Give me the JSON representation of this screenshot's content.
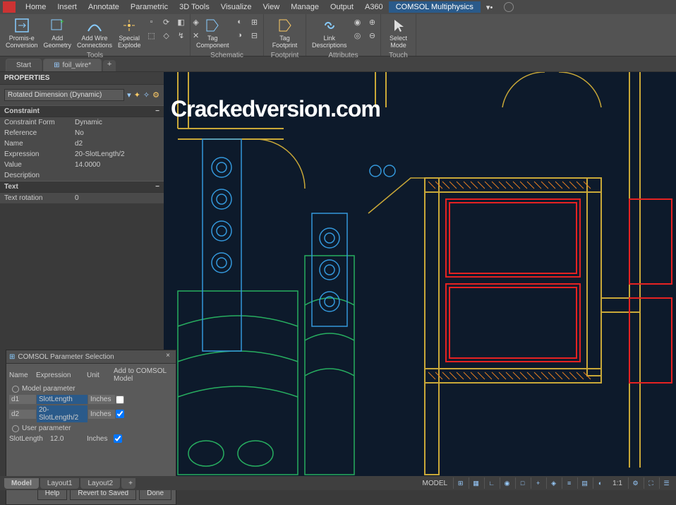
{
  "menu": [
    "Home",
    "Insert",
    "Annotate",
    "Parametric",
    "3D Tools",
    "Visualize",
    "View",
    "Manage",
    "Output",
    "A360"
  ],
  "comsol_tab": "COMSOL Multiphysics",
  "ribbon": {
    "tools": {
      "label": "Tools",
      "promise": "Promis-e Conversion",
      "addgeom": "Add Geometry",
      "addwire": "Add Wire Connections",
      "explode": "Special Explode"
    },
    "schematic": {
      "label": "Schematic",
      "tagcomp": "Tag Component"
    },
    "footprint": {
      "label": "Footprint",
      "tagfp": "Tag Footprint"
    },
    "attributes": {
      "label": "Attributes",
      "linkdesc": "Link Descriptions"
    },
    "touch": {
      "label": "Touch",
      "selmode": "Select Mode"
    }
  },
  "doc_tabs": {
    "start": "Start",
    "file": "foil_wire*"
  },
  "props": {
    "title": "PROPERTIES",
    "selector": "Rotated Dimension (Dynamic)",
    "sections": {
      "constraint": {
        "title": "Constraint",
        "rows": [
          {
            "label": "Constraint Form",
            "value": "Dynamic"
          },
          {
            "label": "Reference",
            "value": "No"
          },
          {
            "label": "Name",
            "value": "d2"
          },
          {
            "label": "Expression",
            "value": "20-SlotLength/2"
          },
          {
            "label": "Value",
            "value": "14.0000"
          },
          {
            "label": "Description",
            "value": ""
          }
        ]
      },
      "text": {
        "title": "Text",
        "rows": [
          {
            "label": "Text rotation",
            "value": "0"
          }
        ]
      }
    }
  },
  "dialog": {
    "title": "COMSOL Parameter Selection",
    "headers": {
      "name": "Name",
      "expr": "Expression",
      "unit": "Unit",
      "add": "Add to COMSOL Model"
    },
    "radio_model": "Model parameter",
    "radio_user": "User parameter",
    "rows": [
      {
        "name": "d1",
        "expr": "SlotLength",
        "unit": "Inches",
        "checked": false
      },
      {
        "name": "d2",
        "expr": "20-SlotLength/2",
        "unit": "Inches",
        "checked": true
      }
    ],
    "user_row": {
      "name": "SlotLength",
      "value": "12.0",
      "unit": "Inches",
      "checked": true
    },
    "buttons": {
      "help": "Help",
      "revert": "Revert to Saved",
      "done": "Done"
    }
  },
  "bottom_tabs": [
    "Model",
    "Layout1",
    "Layout2"
  ],
  "status": {
    "model": "MODEL",
    "ratio": "1:1"
  },
  "watermark": "Crackedversion.com"
}
